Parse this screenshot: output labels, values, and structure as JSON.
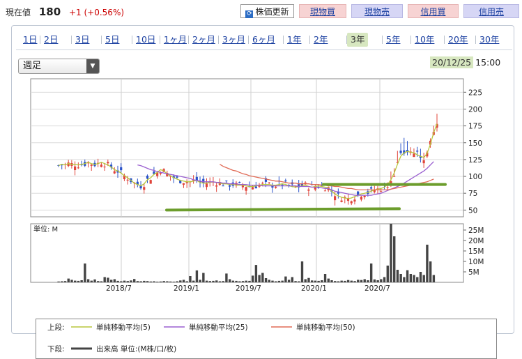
{
  "quote": {
    "price_label": "現在値",
    "price": "180",
    "change": "+1 (+0.56%)"
  },
  "buttons": {
    "refresh": "株価更新",
    "cash_buy": "現物買",
    "cash_sell": "現物売",
    "margin_buy": "信用買",
    "margin_sell": "信用売"
  },
  "period_tabs": [
    "1日",
    "2日",
    "3日",
    "5日",
    "10日",
    "1ヶ月",
    "2ヶ月",
    "3ヶ月",
    "6ヶ月",
    "1年",
    "2年",
    "3年",
    "5年",
    "10年",
    "20年",
    "30年"
  ],
  "active_tab": "3年",
  "interval_select": "週足",
  "as_of": {
    "date": "20/12/25",
    "time": "15:00"
  },
  "colors": {
    "up": "#e0443a",
    "down": "#2a52c9",
    "ma5": "#b7c63b",
    "ma25": "#9a5fd0",
    "ma50": "#e06a55",
    "trend": "#6c9d2c",
    "volume": "#444444",
    "link": "#1a3fa0"
  },
  "chart_data": [
    {
      "type": "candlestick",
      "title": "",
      "y_ticks": [
        "225",
        "200",
        "175",
        "150",
        "125",
        "100",
        "75",
        "50"
      ],
      "ylim": [
        40,
        245
      ],
      "x_ticks": [
        "2018/7",
        "2019/1",
        "2019/7",
        "2020/1",
        "2020/7"
      ],
      "series": [
        {
          "name": "単純移動平均(5)",
          "values": [
            116,
            118,
            117,
            119,
            118,
            118,
            117,
            118,
            119,
            121,
            119,
            118,
            119,
            121,
            119,
            117,
            114,
            110,
            108,
            105,
            101,
            98,
            94,
            90,
            88,
            86,
            89,
            95,
            98,
            103,
            106,
            110,
            108,
            104,
            101,
            98,
            96,
            94,
            93,
            92,
            92,
            93,
            94,
            91,
            90,
            90,
            91,
            92,
            91,
            90,
            89,
            89,
            88,
            88,
            87,
            87,
            87,
            86,
            85,
            85,
            86,
            87,
            88,
            88,
            88,
            87,
            87,
            88,
            89,
            88,
            86,
            85,
            84,
            85,
            86,
            87,
            85,
            84,
            85,
            86,
            85,
            84,
            83,
            78,
            74,
            71,
            69,
            68,
            67,
            68,
            70,
            72,
            74,
            75,
            76,
            78,
            80,
            81,
            82,
            84,
            88,
            95,
            105,
            118,
            130,
            135,
            137,
            136,
            135,
            132,
            130,
            128,
            134,
            148,
            165,
            178
          ]
        },
        {
          "name": "単純移動平均(25)",
          "values": [
            null,
            null,
            null,
            null,
            null,
            null,
            null,
            null,
            null,
            null,
            null,
            null,
            null,
            null,
            null,
            null,
            null,
            null,
            null,
            null,
            null,
            null,
            null,
            null,
            117,
            116,
            114,
            112,
            110,
            109,
            107,
            106,
            105,
            104,
            103,
            102,
            101,
            100,
            99,
            98,
            97,
            95,
            94,
            93,
            92,
            92,
            92,
            92,
            91,
            91,
            90,
            90,
            89,
            89,
            89,
            88,
            88,
            88,
            87,
            87,
            87,
            87,
            86,
            86,
            86,
            86,
            86,
            86,
            86,
            86,
            86,
            86,
            86,
            85,
            85,
            85,
            85,
            84,
            84,
            84,
            83,
            82,
            82,
            80,
            78,
            77,
            76,
            75,
            74,
            73,
            72,
            72,
            72,
            72,
            72,
            72,
            73,
            74,
            75,
            77,
            79,
            81,
            83,
            85,
            87,
            90,
            93,
            96,
            99,
            102,
            105,
            108,
            112,
            117,
            122
          ]
        },
        {
          "name": "単純移動平均(50)",
          "values": [
            null,
            null,
            null,
            null,
            null,
            null,
            null,
            null,
            null,
            null,
            null,
            null,
            null,
            null,
            null,
            null,
            null,
            null,
            null,
            null,
            null,
            null,
            null,
            null,
            null,
            null,
            null,
            null,
            null,
            null,
            null,
            null,
            null,
            null,
            null,
            null,
            null,
            null,
            null,
            null,
            null,
            null,
            null,
            null,
            null,
            null,
            null,
            null,
            null,
            118,
            115,
            113,
            111,
            109,
            108,
            106,
            104,
            103,
            101,
            100,
            99,
            98,
            97,
            96,
            95,
            94,
            93,
            93,
            92,
            91,
            90,
            90,
            90,
            89,
            89,
            89,
            89,
            88,
            88,
            88,
            87,
            87,
            86,
            86,
            85,
            85,
            84,
            83,
            82,
            82,
            81,
            80,
            80,
            80,
            80,
            80,
            80,
            80,
            80,
            80,
            80,
            81,
            82,
            83,
            84,
            85,
            86,
            87,
            88,
            89,
            90,
            91,
            92,
            94,
            96
          ]
        }
      ],
      "annotations": [
        "support line ~50 (2019/1–2020/8)",
        "resistance line ~87 (2020/1–2020/12)"
      ]
    },
    {
      "type": "bar",
      "title": "単位: M",
      "y_ticks": [
        "25M",
        "20M",
        "15M",
        "10M",
        "5M"
      ],
      "ylim": [
        0,
        28
      ],
      "x_ticks": [
        "2018/7",
        "2019/1",
        "2019/7",
        "2020/1",
        "2020/7"
      ],
      "series": [
        {
          "name": "出来高",
          "values": [
            0.4,
            0.5,
            0.6,
            1.8,
            1.2,
            0.8,
            0.7,
            1.0,
            9.0,
            1.5,
            0.8,
            1.4,
            0.6,
            0.5,
            2.5,
            2.2,
            1.2,
            1.5,
            0.7,
            0.5,
            0.8,
            0.6,
            0.9,
            1.6,
            0.6,
            0.5,
            0.7,
            0.6,
            0.4,
            0.5,
            0.3,
            0.4,
            0.6,
            0.5,
            0.4,
            0.3,
            0.5,
            0.9,
            1.2,
            0.5,
            3.0,
            0.8,
            5.7,
            1.2,
            4.5,
            0.8,
            0.6,
            0.7,
            0.9,
            0.5,
            0.6,
            4.2,
            1.5,
            0.8,
            0.7,
            0.5,
            0.6,
            0.8,
            0.7,
            3.2,
            8.3,
            3.5,
            4.5,
            2.0,
            1.2,
            0.8,
            0.5,
            0.7,
            0.8,
            2.8,
            1.2,
            2.5,
            0.6,
            0.5,
            10.0,
            1.5,
            2.1,
            0.9,
            0.8,
            0.7,
            1.0,
            4.0,
            1.8,
            1.0,
            0.6,
            0.5,
            0.8,
            0.7,
            1.1,
            0.8,
            0.6,
            1.2,
            1.1,
            1.5,
            1.0,
            9.0,
            1.4,
            1.0,
            1.5,
            2.5,
            8.0,
            28.0,
            22.0,
            6.0,
            4.0,
            2.5,
            5.8,
            4.0,
            3.5,
            2.5,
            5.0,
            3.5,
            18.0,
            10.0,
            3.5
          ]
        }
      ]
    }
  ],
  "legend": {
    "upper_label": "上段:",
    "lower_label": "下段:",
    "ma5": "単純移動平均(5)",
    "ma25": "単純移動平均(25)",
    "ma50": "単純移動平均(50)",
    "volume": "出来高 単位:(M株/口/枚)"
  }
}
